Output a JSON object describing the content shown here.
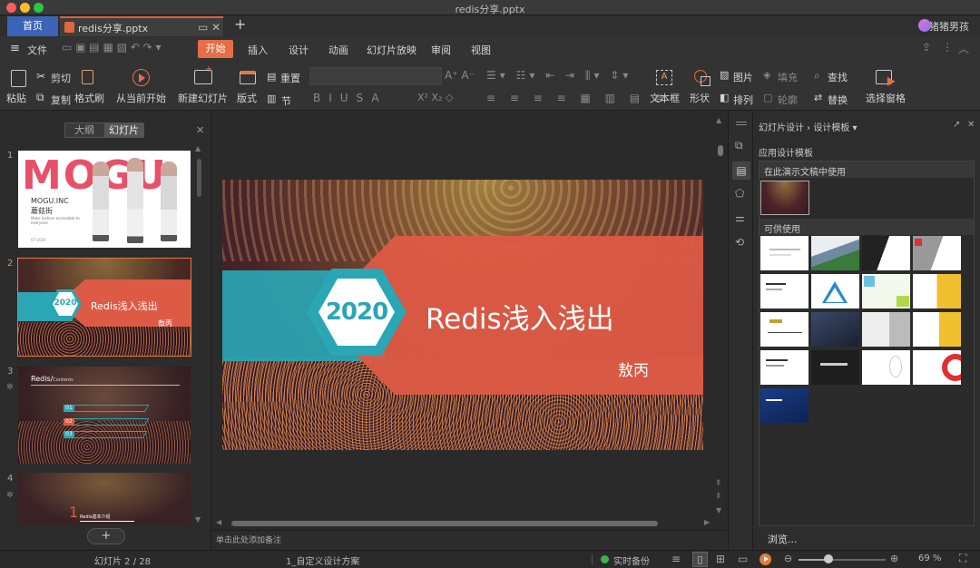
{
  "window": {
    "title": "redis分享.pptx",
    "user_name": "猪猪男孩"
  },
  "tabs": {
    "home": "首页",
    "document": "redis分享.pptx"
  },
  "menu": {
    "file": "文件",
    "items": [
      "开始",
      "插入",
      "设计",
      "动画",
      "幻灯片放映",
      "审阅",
      "视图"
    ]
  },
  "ribbon": {
    "paste": "粘贴",
    "cut": "剪切",
    "copy": "复制",
    "format_painter": "格式刷",
    "from_current": "从当前开始",
    "new_slide": "新建幻灯片",
    "layout": "版式",
    "reset": "重置",
    "section": "节",
    "textbox": "文本框",
    "shape": "形状",
    "picture": "图片",
    "fill": "填充",
    "arrange": "排列",
    "outline": "轮廓",
    "find": "查找",
    "replace": "替换",
    "select_pane": "选择窗格"
  },
  "outline": {
    "tab_outline": "大纲",
    "tab_slides": "幻灯片",
    "add_button": "+"
  },
  "thumbnails": [
    {
      "num": "1",
      "title": "MOGU",
      "subtitle": "MOGU.INC",
      "subtitle2": "蘑菇街",
      "caption": "Make fashion accessible to everyone",
      "date": "07-2020"
    },
    {
      "num": "2",
      "badge": "2020",
      "title": "Redis浅入浅出",
      "author": "敖丙"
    },
    {
      "num": "3",
      "title": "Redis/",
      "title_suffix": "Contents",
      "items": [
        "01",
        "02",
        "03"
      ]
    },
    {
      "num": "4",
      "big_num": "1",
      "label": "Redis基本介绍"
    }
  ],
  "slide": {
    "badge": "2020",
    "title": "Redis浅入浅出",
    "author": "敖丙"
  },
  "notes": {
    "placeholder": "单击此处添加备注"
  },
  "design_panel": {
    "breadcrumb": "幻灯片设计 › 设计模板",
    "apply_label": "应用设计模板",
    "used_label": "在此演示文稿中使用",
    "available_label": "可供使用",
    "browse": "浏览..."
  },
  "status": {
    "slide_counter": "幻灯片 2 / 28",
    "theme": "1_自定义设计方案",
    "backup": "实时备份",
    "zoom": "69 %"
  },
  "colors": {
    "accent": "#e66d45",
    "home_tab": "#3b63b8",
    "teal": "#2aa6b4",
    "coral": "#dd5a45"
  }
}
